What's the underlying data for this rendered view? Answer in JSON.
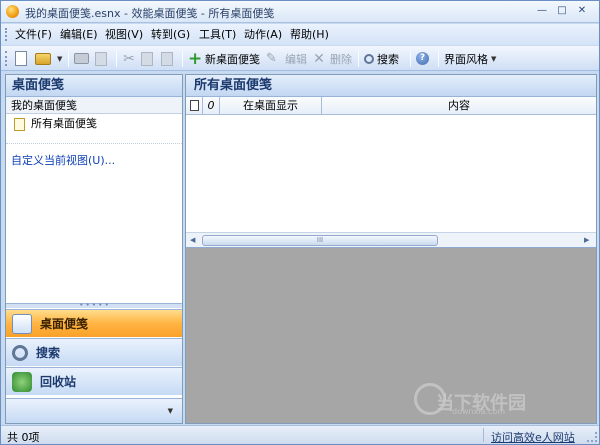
{
  "window": {
    "title": "我的桌面便笺.esnx - 效能桌面便笺 - 所有桌面便笺",
    "minimize_symbol": "—",
    "maximize_symbol": "□",
    "close_symbol": "✕"
  },
  "menu": [
    "文件(F)",
    "编辑(E)",
    "视图(V)",
    "转到(G)",
    "工具(T)",
    "动作(A)",
    "帮助(H)"
  ],
  "toolbar": {
    "new_note": "新桌面便笺",
    "edit": "编辑",
    "delete": "删除",
    "search": "搜索",
    "help_symbol": "?",
    "theme": "界面风格"
  },
  "left_pane": {
    "title": "桌面便笺",
    "section": "我的桌面便笺",
    "tree_item": "所有桌面便笺",
    "custom_view": "自定义当前视图(U)..."
  },
  "nav": {
    "notes": "桌面便笺",
    "search": "搜索",
    "recycle": "回收站"
  },
  "right_pane": {
    "title": "所有桌面便笺",
    "columns": [
      "在桌面显示",
      "内容"
    ],
    "scroll_thumb": "III"
  },
  "status": {
    "count": "共 0项",
    "link": "访问高效e人网站"
  },
  "watermark": {
    "text": "当下软件园",
    "small": "downxia.com"
  },
  "colors": {
    "accent": "#ffb443",
    "header_text": "#1c3a6e",
    "link": "#0c3fb8"
  }
}
